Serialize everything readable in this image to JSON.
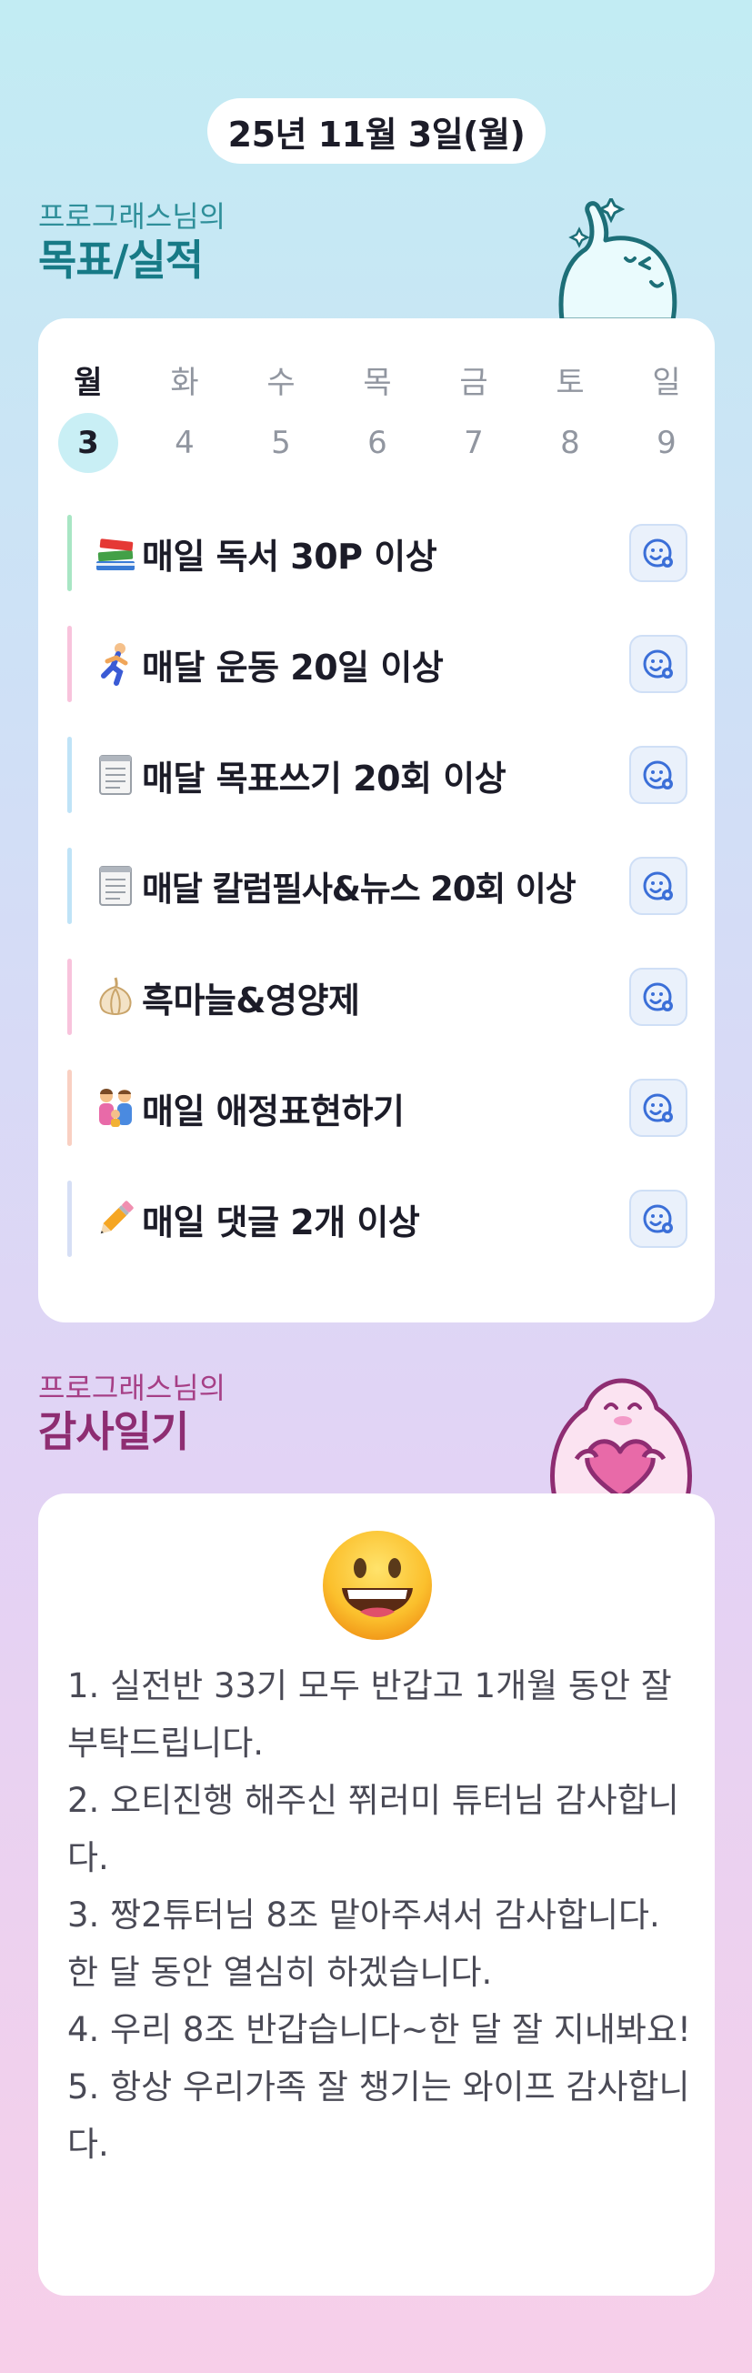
{
  "header": {
    "date": "25년 11월 3일(월)"
  },
  "goals_section": {
    "owner_label": "프로그래스님의",
    "title": "목표/실적",
    "week": [
      {
        "day": "월",
        "date": "3",
        "active": true
      },
      {
        "day": "화",
        "date": "4",
        "active": false
      },
      {
        "day": "수",
        "date": "5",
        "active": false
      },
      {
        "day": "목",
        "date": "6",
        "active": false
      },
      {
        "day": "금",
        "date": "7",
        "active": false
      },
      {
        "day": "토",
        "date": "8",
        "active": false
      },
      {
        "day": "일",
        "date": "9",
        "active": false
      }
    ],
    "goals": [
      {
        "icon": "books-icon",
        "label": "매일 독서 30P 이상",
        "accent": "#a8e6c4",
        "status_icon": "face-status-icon"
      },
      {
        "icon": "runner-icon",
        "label": "매달 운동 20일 이상",
        "accent": "#f8c3dc",
        "status_icon": "face-status-icon"
      },
      {
        "icon": "notepad-icon",
        "label": "매달 목표쓰기 20회 이상",
        "accent": "#bfe3f7",
        "status_icon": "face-status-icon"
      },
      {
        "icon": "notepad-icon",
        "label": "매달 칼럼필사&뉴스 20회 이상",
        "accent": "#bfe3f7",
        "status_icon": "face-status-icon"
      },
      {
        "icon": "garlic-icon",
        "label": "흑마늘&영양제",
        "accent": "#f8c3dc",
        "status_icon": "face-status-icon"
      },
      {
        "icon": "family-icon",
        "label": "매일 애정표현하기",
        "accent": "#f9d0c2",
        "status_icon": "face-status-icon"
      },
      {
        "icon": "pencil-icon",
        "label": "매일 댓글 2개 이상",
        "accent": "#d6dff5",
        "status_icon": "face-status-icon"
      }
    ]
  },
  "thanks_section": {
    "owner_label": "프로그래스님의",
    "title": "감사일기",
    "mood_icon": "grinning-face-icon",
    "entries": [
      "1. 실전반 33기 모두 반갑고 1개월 동안 잘 부탁드립니다.",
      "2. 오티진행 해주신 쮜러미 튜터님 감사합니다.",
      "3. 짱2튜터님 8조 맡아주셔서 감사합니다. 한 달 동안 열심히 하겠습니다.",
      "4. 우리 8조 반갑습니다~한 달 잘 지내봐요!",
      "5. 항상 우리가족 잘 챙기는 와이프 감사합니다."
    ]
  },
  "colors": {
    "goals_title": "#177a86",
    "thanks_title": "#8e2d72",
    "active_day_bg": "#c9eff5",
    "status_button_bg": "#eaf1fb",
    "status_icon": "#3b6fd8"
  }
}
